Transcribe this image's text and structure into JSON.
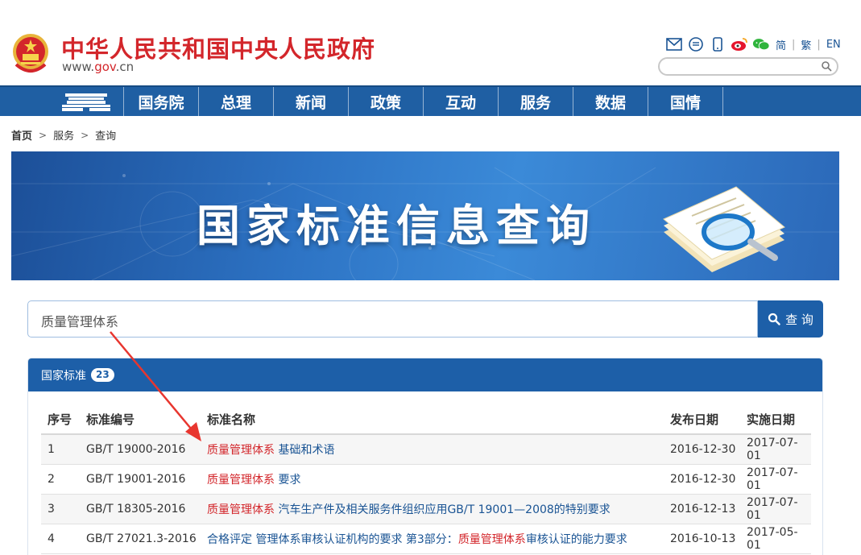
{
  "header": {
    "title": "中华人民共和国中央人民政府",
    "domain_prefix": "www.",
    "domain_gov": "gov",
    "domain_suffix": ".cn",
    "lang_simplified": "简",
    "lang_traditional": "繁",
    "lang_english": "EN",
    "search_placeholder": ""
  },
  "nav": {
    "items": [
      "国务院",
      "总理",
      "新闻",
      "政策",
      "互动",
      "服务",
      "数据",
      "国情"
    ]
  },
  "breadcrumb": {
    "home": "首页",
    "level1": "服务",
    "level2": "查询"
  },
  "banner": {
    "title": "国家标准信息查询"
  },
  "search": {
    "value": "质量管理体系",
    "button_label": "查 询"
  },
  "results": {
    "title": "国家标准",
    "count": "23",
    "columns": [
      "序号",
      "标准编号",
      "标准名称",
      "发布日期",
      "实施日期"
    ],
    "rows": [
      {
        "no": "1",
        "code": "GB/T 19000-2016",
        "pre": "",
        "hl": "质量管理体系",
        "post": " 基础和术语",
        "pub": "2016-12-30",
        "impl": "2017-07-01"
      },
      {
        "no": "2",
        "code": "GB/T 19001-2016",
        "pre": "",
        "hl": "质量管理体系",
        "post": " 要求",
        "pub": "2016-12-30",
        "impl": "2017-07-01"
      },
      {
        "no": "3",
        "code": "GB/T 18305-2016",
        "pre": "",
        "hl": "质量管理体系",
        "post": " 汽车生产件及相关服务件组织应用GB/T 19001—2008的特别要求",
        "pub": "2016-12-13",
        "impl": "2017-07-01"
      },
      {
        "no": "4",
        "code": "GB/T 27021.3-2016",
        "pre": "合格评定 管理体系审核认证机构的要求 第3部分：",
        "hl": "质量管理体系",
        "post": "审核认证的能力要求",
        "pub": "2016-10-13",
        "impl": "2017-05-01"
      }
    ]
  },
  "colors": {
    "brand_red": "#d3262b",
    "nav_blue": "#1f5fa3",
    "link_blue": "#1a5494"
  }
}
